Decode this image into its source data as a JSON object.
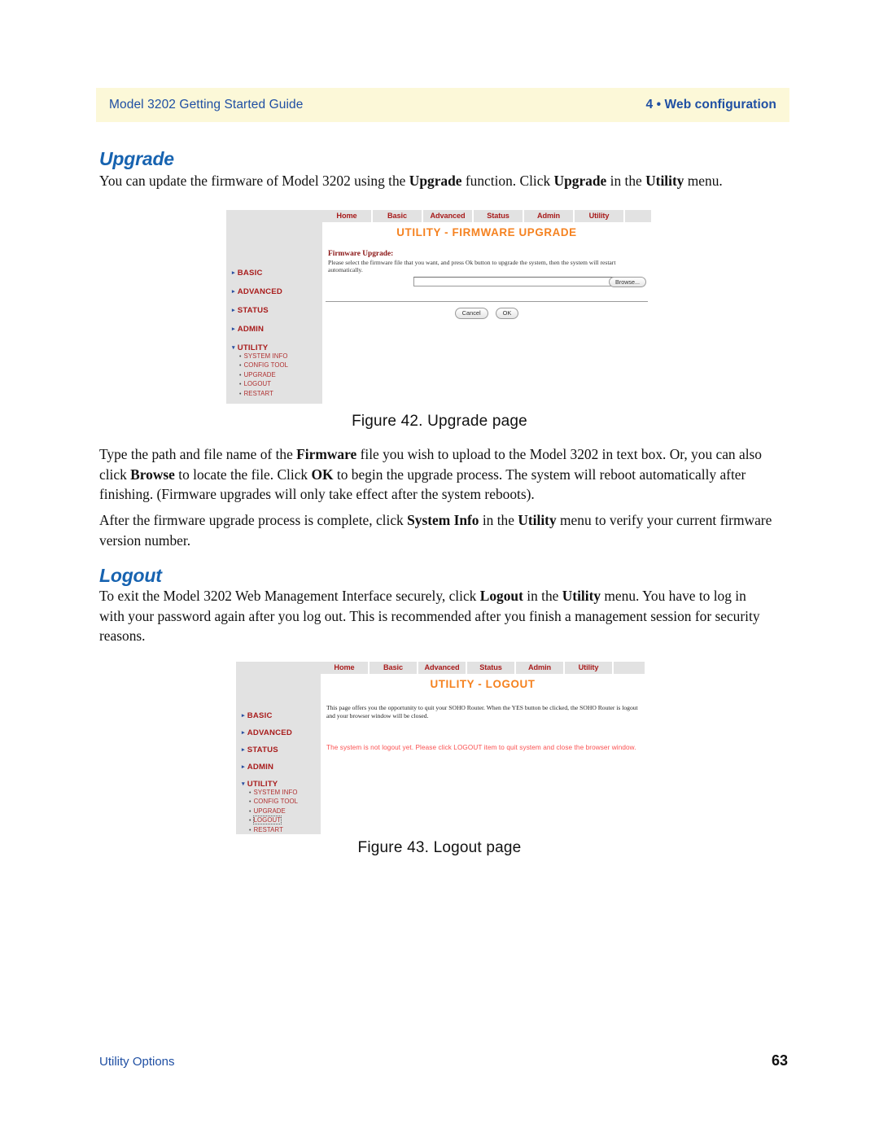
{
  "header": {
    "left": "Model 3202 Getting Started Guide",
    "right": "4 • Web configuration",
    "background": "#fcf8d8",
    "text_color": "#1f4fa3"
  },
  "sections": {
    "upgrade": {
      "heading": "Upgrade",
      "intro": "You can update the firmware of Model 3202 using the Upgrade function. Click Upgrade in the Utility menu.",
      "after_figure": "Type the path and file name of the Firmware file you wish to upload to the Model 3202 in text box. Or, you can also click Browse to locate the file. Click OK to begin the upgrade process. The system will reboot automatically after finishing. (Firmware upgrades will only take effect after the system reboots).",
      "system_info": "After the firmware upgrade process is complete, click System Info in the Utility menu to verify your current firmware version number."
    },
    "logout": {
      "heading": "Logout",
      "intro": "To exit the Model 3202 Web Management Interface securely, click Logout in the Utility menu. You have to log in with your password again after you log out. This is recommended after you finish a management session for security reasons."
    }
  },
  "captions": {
    "figure_42": "Figure 42. Upgrade page",
    "figure_43": "Figure 43. Logout page"
  },
  "figure_42": {
    "nav": [
      "Home",
      "Basic",
      "Advanced",
      "Status",
      "Admin",
      "Utility"
    ],
    "title": "UTILITY - FIRMWARE UPGRADE",
    "title_color": "#f58220",
    "firmware_label": "Firmware Upgrade:",
    "firmware_desc": "Please select the firmware file that you want, and press Ok button to upgrade the system, then the system will restart automatically.",
    "file_input_value": "",
    "browse_label": "Browse...",
    "cancel_label": "Cancel",
    "ok_label": "OK",
    "sidebar": {
      "main_items": [
        "BASIC",
        "ADVANCED",
        "STATUS",
        "ADMIN",
        "UTILITY"
      ],
      "sub_items": [
        "SYSTEM INFO",
        "CONFIG TOOL",
        "UPGRADE",
        "LOGOUT",
        "RESTART"
      ],
      "expanded_item": "UTILITY",
      "collapsed_caret": "▸",
      "expanded_caret": "▾",
      "bullet": "•",
      "link_color": "#a81c1c"
    }
  },
  "figure_43": {
    "nav": [
      "Home",
      "Basic",
      "Advanced",
      "Status",
      "Admin",
      "Utility"
    ],
    "title": "UTILITY - LOGOUT",
    "title_color": "#f58220",
    "description": "This page offers you the opportunity to quit your SOHO Router. When the YES button be clicked, the SOHO Router is logout and your browser window will be closed.",
    "warning": "The system is not logout yet. Please click LOGOUT item to quit system and close the browser window.",
    "warning_color": "#fa5050",
    "sidebar": {
      "main_items": [
        "BASIC",
        "ADVANCED",
        "STATUS",
        "ADMIN",
        "UTILITY"
      ],
      "sub_items": [
        "SYSTEM INFO",
        "CONFIG TOOL",
        "UPGRADE",
        "LOGOUT",
        "RESTART"
      ],
      "expanded_item": "UTILITY",
      "focused_sub_item": "LOGOUT",
      "collapsed_caret": "▸",
      "expanded_caret": "▾",
      "bullet": "•",
      "link_color": "#a81c1c"
    }
  },
  "footer": {
    "left": "Utility Options",
    "page_number": "63"
  }
}
